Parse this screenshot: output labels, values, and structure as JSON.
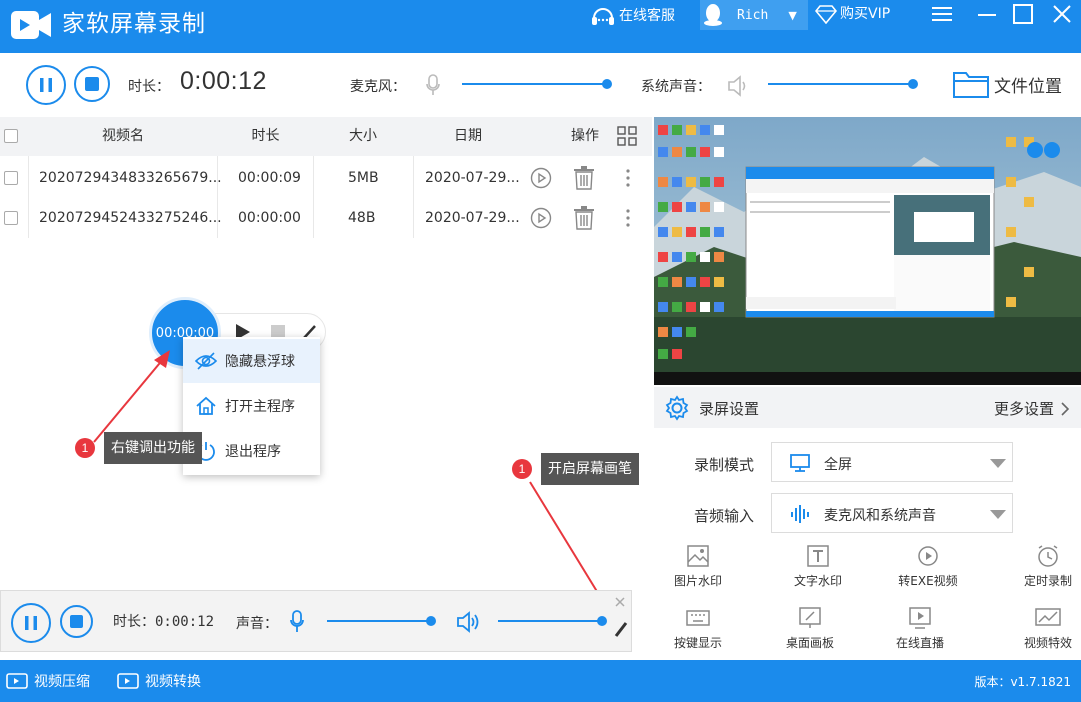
{
  "titlebar": {
    "title": "家软屏幕录制",
    "service": "在线客服",
    "user": "Rich",
    "vip": "购买VIP"
  },
  "toolbar": {
    "duration_label": "时长：",
    "duration": "0:00:12",
    "mic_label": "麦克风：",
    "system_sound_label": "系统声音：",
    "file_location": "文件位置",
    "mic_level": 0.98,
    "system_level": 0.98
  },
  "table": {
    "headers": [
      "视频名",
      "时长",
      "大小",
      "日期",
      "操作"
    ],
    "rows": [
      {
        "name": "2020729434833265679...",
        "duration": "00:00:09",
        "size": "5MB",
        "date": "2020-07-29..."
      },
      {
        "name": "2020729452433275246...",
        "duration": "00:00:00",
        "size": "48B",
        "date": "2020-07-29..."
      }
    ]
  },
  "float_ball": {
    "time": "00:00:00",
    "menu": [
      "隐藏悬浮球",
      "打开主程序",
      "退出程序"
    ]
  },
  "annotations": {
    "right_click": {
      "badge": "1",
      "text": "右键调出功能"
    },
    "pen": {
      "badge": "1",
      "text": "开启屏幕画笔"
    }
  },
  "mini_bar": {
    "duration_label": "时长：",
    "duration": "0:00:12",
    "sound_label": "声音：",
    "mic_level": 0.98,
    "system_level": 0.98
  },
  "settings": {
    "title": "录屏设置",
    "more": "更多设置",
    "mode_label": "录制模式",
    "mode_value": "全屏",
    "audio_label": "音频输入",
    "audio_value": "麦克风和系统声音"
  },
  "tools": [
    "图片水印",
    "文字水印",
    "转EXE视频",
    "定时录制",
    "按键显示",
    "桌面画板",
    "在线直播",
    "视频特效"
  ],
  "bottombar": {
    "compress": "视频压缩",
    "convert": "视频转换",
    "version": "版本：v1.7.1821"
  },
  "colors": {
    "primary": "#1b8bec",
    "badge": "#e8373e"
  }
}
